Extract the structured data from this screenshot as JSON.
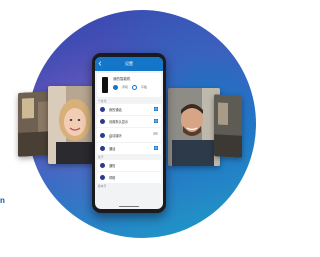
{
  "brand": {
    "visible_text": "n",
    "color": "#0a5aa5"
  },
  "phone": {
    "appbar_title": "设置",
    "top_card": {
      "title": "我的智能机",
      "options": [
        "手机",
        "平板"
      ]
    },
    "section_a": "个性化",
    "rows_a": [
      {
        "label": "我的通话",
        "has_windows_icon": true
      },
      {
        "label": "设置默认显示",
        "has_windows_icon": true
      },
      {
        "label": "自动接听",
        "sub": "开",
        "has_toggle": true
      },
      {
        "label": "通话",
        "has_windows_icon": true
      }
    ],
    "section_b": "关于",
    "rows_b": [
      {
        "label": "通知"
      },
      {
        "label": "帮助"
      }
    ],
    "section_c": "版本号"
  },
  "colors": {
    "accent": "#1476c8",
    "orb_start": "#2d4bb0",
    "orb_end": "#1aa0c8"
  },
  "icons": {
    "back": "arrow-left-icon",
    "windows": "windows-logo-icon",
    "setting_row": "settings-circle-icon"
  }
}
